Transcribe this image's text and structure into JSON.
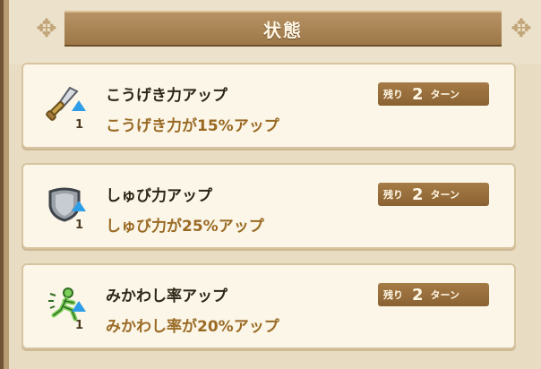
{
  "header": {
    "title": "状態"
  },
  "colors": {
    "title_bar": "#a9844f",
    "card_bg": "#fbf6e8",
    "desc_text": "#9a6a24",
    "turns_badge": "#96703d",
    "buff_arrow": "#2e9de8"
  },
  "statuses": [
    {
      "icon": "sword-icon",
      "name": "こうげき力アップ",
      "stack": "1",
      "description": "こうげき力が15%アップ",
      "turns_label": "残り",
      "turns_value": "2",
      "turns_unit": "ターン"
    },
    {
      "icon": "shield-icon",
      "name": "しゅび力アップ",
      "stack": "1",
      "description": "しゅび力が25%アップ",
      "turns_label": "残り",
      "turns_value": "2",
      "turns_unit": "ターン"
    },
    {
      "icon": "evasion-figure-icon",
      "name": "みかわし率アップ",
      "stack": "1",
      "description": "みかわし率が20%アップ",
      "turns_label": "残り",
      "turns_value": "2",
      "turns_unit": "ターン"
    }
  ]
}
